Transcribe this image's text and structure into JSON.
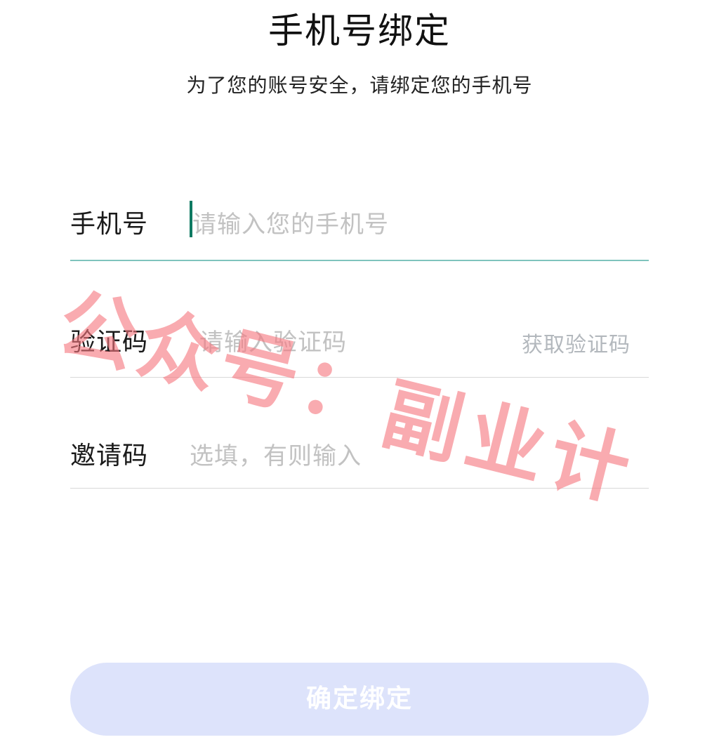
{
  "header": {
    "title": "手机号绑定",
    "subtitle": "为了您的账号安全，请绑定您的手机号"
  },
  "form": {
    "phone": {
      "label": "手机号",
      "placeholder": "请输入您的手机号"
    },
    "code": {
      "label": "验证码",
      "placeholder": "请输入验证码",
      "action": "获取验证码"
    },
    "invite": {
      "label": "邀请码",
      "placeholder": "选填，有则输入"
    }
  },
  "confirm_button": {
    "label": "确定绑定"
  },
  "watermark": {
    "line1": "公众号：",
    "line2": "副业计"
  },
  "colors": {
    "caret": "#0e7a62",
    "active_underline": "#7fc4bd",
    "button_bg": "#dde3fb",
    "watermark": "#f67880"
  }
}
